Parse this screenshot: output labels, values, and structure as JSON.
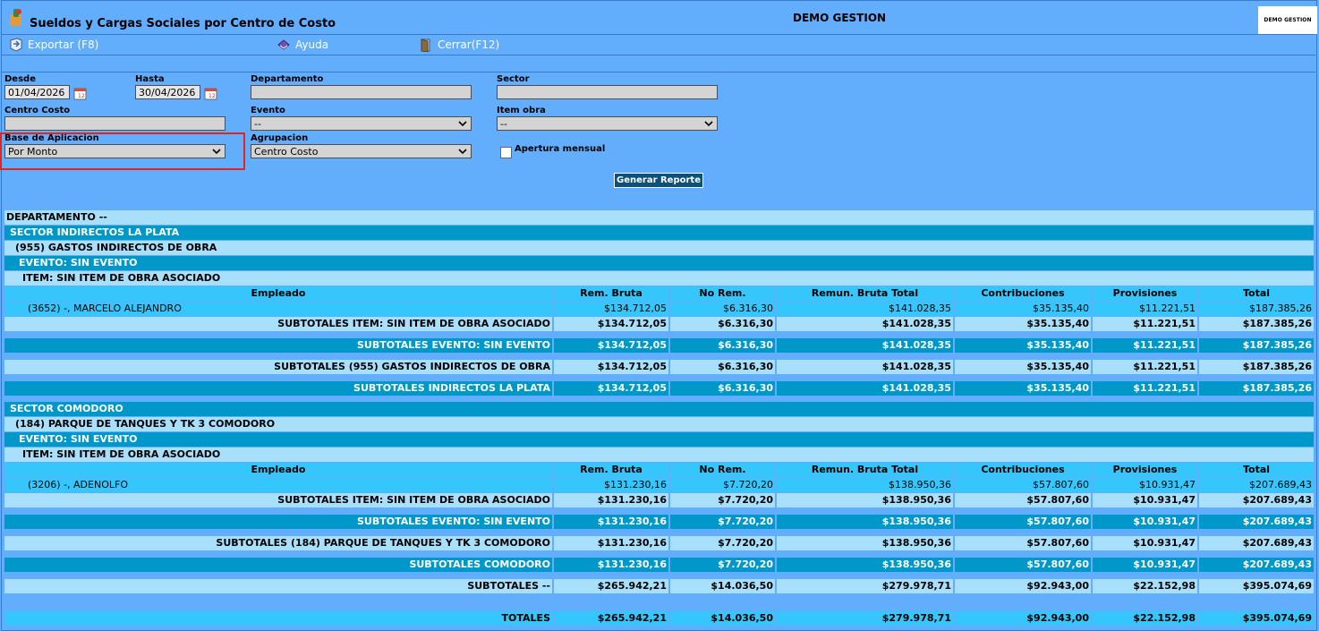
{
  "window": {
    "title": "Sueldos y Cargas Sociales por Centro de Costo",
    "company": "DEMO GESTION",
    "logo_text": "DEMO GESTION"
  },
  "toolbar": {
    "export_label": "Exportar (F8)",
    "help_label": "Ayuda",
    "close_label": "Cerrar(F12)"
  },
  "filters": {
    "desde_label": "Desde",
    "desde_value": "01/04/2026",
    "hasta_label": "Hasta",
    "hasta_value": "30/04/2026",
    "departamento_label": "Departamento",
    "departamento_value": "",
    "sector_label": "Sector",
    "sector_value": "",
    "centro_costo_label": "Centro Costo",
    "centro_costo_value": "",
    "evento_label": "Evento",
    "evento_value": "--",
    "item_obra_label": "Item obra",
    "item_obra_value": "--",
    "base_label": "Base de Aplicacion",
    "base_value": "Por Monto",
    "agrupacion_label": "Agrupacion",
    "agrupacion_value": "Centro Costo",
    "apertura_label": "Apertura mensual",
    "generate_label": "Generar Reporte"
  },
  "report": {
    "department": "DEPARTAMENTO --",
    "columns": [
      "Empleado",
      "Rem. Bruta",
      "No Rem.",
      "Remun. Bruta Total",
      "Contribuciones",
      "Provisiones",
      "Total"
    ],
    "sector1": {
      "title": "SECTOR INDIRECTOS LA PLATA",
      "cost_center": "(955) GASTOS INDIRECTOS DE OBRA",
      "event": "EVENTO: SIN EVENTO",
      "item": "ITEM: SIN ITEM DE OBRA ASOCIADO",
      "employee": {
        "name": "(3652) -, MARCELO ALEJANDRO",
        "v": [
          "$134.712,05",
          "$6.316,30",
          "$141.028,35",
          "$35.135,40",
          "$11.221,51",
          "$187.385,26"
        ]
      },
      "sub_item": {
        "label": "SUBTOTALES ITEM: SIN ITEM DE OBRA ASOCIADO",
        "v": [
          "$134.712,05",
          "$6.316,30",
          "$141.028,35",
          "$35.135,40",
          "$11.221,51",
          "$187.385,26"
        ]
      },
      "sub_event": {
        "label": "SUBTOTALES EVENTO: SIN EVENTO",
        "v": [
          "$134.712,05",
          "$6.316,30",
          "$141.028,35",
          "$35.135,40",
          "$11.221,51",
          "$187.385,26"
        ]
      },
      "sub_cc": {
        "label": "SUBTOTALES (955) GASTOS INDIRECTOS DE OBRA",
        "v": [
          "$134.712,05",
          "$6.316,30",
          "$141.028,35",
          "$35.135,40",
          "$11.221,51",
          "$187.385,26"
        ]
      },
      "sub_sector": {
        "label": "SUBTOTALES INDIRECTOS LA PLATA",
        "v": [
          "$134.712,05",
          "$6.316,30",
          "$141.028,35",
          "$35.135,40",
          "$11.221,51",
          "$187.385,26"
        ]
      }
    },
    "sector2": {
      "title": "SECTOR COMODORO",
      "cost_center": "(184) PARQUE DE TANQUES Y TK 3 COMODORO",
      "event": "EVENTO: SIN EVENTO",
      "item": "ITEM: SIN ITEM DE OBRA ASOCIADO",
      "employee": {
        "name": "(3206) -, ADENOLFO",
        "v": [
          "$131.230,16",
          "$7.720,20",
          "$138.950,36",
          "$57.807,60",
          "$10.931,47",
          "$207.689,43"
        ]
      },
      "sub_item": {
        "label": "SUBTOTALES ITEM: SIN ITEM DE OBRA ASOCIADO",
        "v": [
          "$131.230,16",
          "$7.720,20",
          "$138.950,36",
          "$57.807,60",
          "$10.931,47",
          "$207.689,43"
        ]
      },
      "sub_event": {
        "label": "SUBTOTALES EVENTO: SIN EVENTO",
        "v": [
          "$131.230,16",
          "$7.720,20",
          "$138.950,36",
          "$57.807,60",
          "$10.931,47",
          "$207.689,43"
        ]
      },
      "sub_cc": {
        "label": "SUBTOTALES (184) PARQUE DE TANQUES Y TK 3 COMODORO",
        "v": [
          "$131.230,16",
          "$7.720,20",
          "$138.950,36",
          "$57.807,60",
          "$10.931,47",
          "$207.689,43"
        ]
      },
      "sub_sector": {
        "label": "SUBTOTALES COMODORO",
        "v": [
          "$131.230,16",
          "$7.720,20",
          "$138.950,36",
          "$57.807,60",
          "$10.931,47",
          "$207.689,43"
        ]
      }
    },
    "sub_dept": {
      "label": "SUBTOTALES --",
      "v": [
        "$265.942,21",
        "$14.036,50",
        "$279.978,71",
        "$92.943,00",
        "$22.152,98",
        "$395.074,69"
      ]
    },
    "totals": {
      "label": "TOTALES",
      "v": [
        "$265.942,21",
        "$14.036,50",
        "$279.978,71",
        "$92.943,00",
        "$22.152,98",
        "$395.074,69"
      ]
    }
  }
}
